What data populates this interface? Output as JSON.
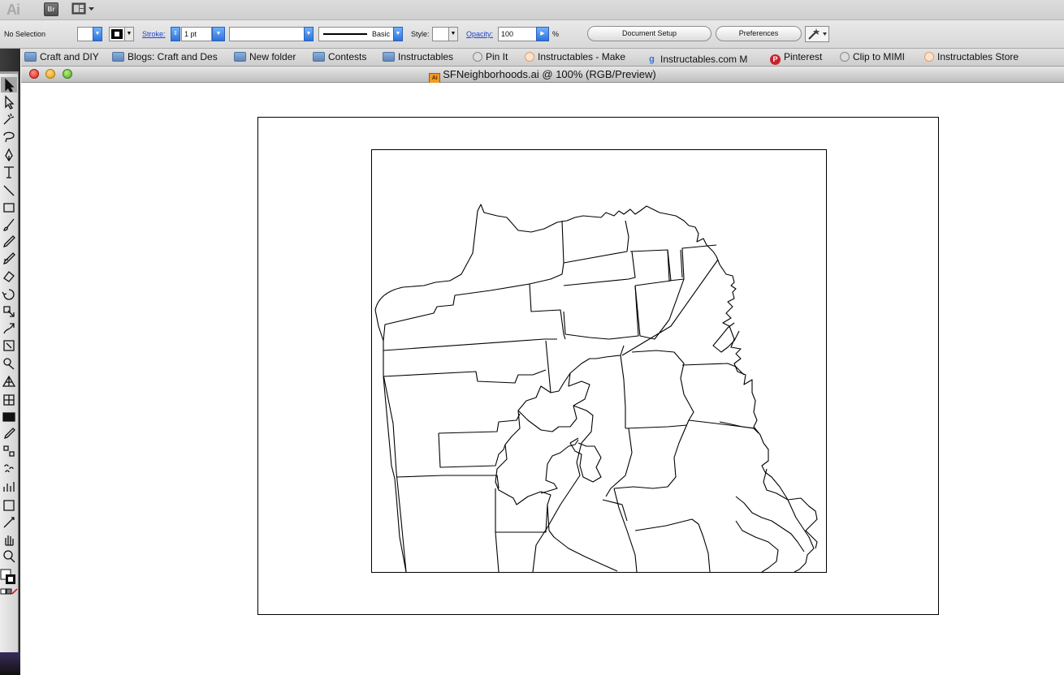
{
  "app": {
    "logo": "Ai",
    "bridge_label": "Br"
  },
  "control_bar": {
    "selection_label": "No Selection",
    "stroke_label": "Stroke:",
    "stroke_weight": "1 pt",
    "brush_label": "Basic",
    "style_label": "Style:",
    "opacity_label": "Opacity:",
    "opacity_value": "100",
    "opacity_unit": "%",
    "document_setup": "Document Setup",
    "preferences": "Preferences"
  },
  "bookmarks": [
    {
      "label": "Craft and DIY",
      "icon": "folder"
    },
    {
      "label": "Blogs: Craft and Des",
      "icon": "folder"
    },
    {
      "label": "New folder",
      "icon": "folder"
    },
    {
      "label": "Contests",
      "icon": "folder"
    },
    {
      "label": "Instructables",
      "icon": "folder"
    },
    {
      "label": "Pin It",
      "icon": "globe"
    },
    {
      "label": "Instructables - Make",
      "icon": "instructables"
    },
    {
      "label": "Instructables.com M",
      "icon": "google"
    },
    {
      "label": "Pinterest",
      "icon": "pinterest"
    },
    {
      "label": "Clip to MIMI",
      "icon": "globe"
    },
    {
      "label": "Instructables Store",
      "icon": "instructables"
    }
  ],
  "window": {
    "title": "SFNeighborhoods.ai @ 100% (RGB/Preview)",
    "doc_icon_label": "Ai"
  },
  "tools": [
    "selection-tool",
    "direct-selection-tool",
    "magic-wand-tool",
    "lasso-tool",
    "pen-tool",
    "type-tool",
    "line-segment-tool",
    "rectangle-tool",
    "paintbrush-tool",
    "pencil-tool",
    "blob-brush-tool",
    "eraser-tool",
    "rotate-tool",
    "scale-tool",
    "warp-tool",
    "free-transform-tool",
    "shape-builder-tool",
    "perspective-grid-tool",
    "mesh-tool",
    "gradient-tool",
    "eyedropper-tool",
    "blend-tool",
    "symbol-sprayer-tool",
    "column-graph-tool",
    "artboard-tool",
    "slice-tool",
    "hand-tool",
    "zoom-tool"
  ]
}
